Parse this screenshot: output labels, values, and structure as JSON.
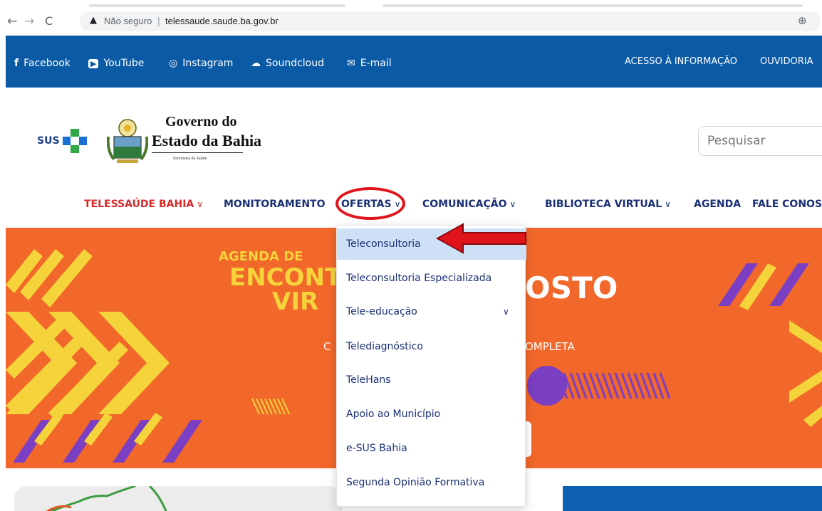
{
  "browser": {
    "url_warning": "Não seguro",
    "url_separator": "|",
    "url": "telessaude.saude.ba.gov.br",
    "back_glyph": "←",
    "forward_glyph": "→",
    "reload_glyph": "C",
    "warn_glyph": "▲",
    "zoom_glyph": "⊕"
  },
  "social": [
    {
      "icon": "facebook-icon",
      "glyph": "f",
      "label": "Facebook"
    },
    {
      "icon": "youtube-icon",
      "glyph": "▶",
      "label": "YouTube"
    },
    {
      "icon": "instagram-icon",
      "glyph": "◎",
      "label": "Instagram"
    },
    {
      "icon": "soundcloud-icon",
      "glyph": "☁",
      "label": "Soundcloud"
    },
    {
      "icon": "email-icon",
      "glyph": "✉",
      "label": "E-mail"
    }
  ],
  "top_links": {
    "info": "ACESSO À INFORMAÇÃO",
    "ouvidoria": "OUVIDORIA"
  },
  "logo": {
    "sus": "SUS",
    "gov_line1": "Governo do",
    "gov_line2": "Estado da Bahia",
    "gov_line3": "Secretaria da Saúde"
  },
  "search": {
    "placeholder": "Pesquisar"
  },
  "nav": [
    {
      "label": "TELESSAÚDE BAHIA",
      "chevron": "∨"
    },
    {
      "label": "MONITORAMENTO",
      "chevron": ""
    },
    {
      "label": "OFERTAS",
      "chevron": "∨"
    },
    {
      "label": "COMUNICAÇÃO",
      "chevron": "∨"
    },
    {
      "label": "BIBLIOTECA VIRTUAL",
      "chevron": "∨"
    },
    {
      "label": "AGENDA",
      "chevron": ""
    },
    {
      "label": "FALE CONOS",
      "chevron": ""
    }
  ],
  "banner": {
    "title1": "AGENDA DE",
    "title2": "ENCONT",
    "title3": "VIR",
    "big": "OSTO",
    "sub_left": "C",
    "sub_right": "OMPLETA"
  },
  "dropdown": {
    "items": [
      {
        "label": "Teleconsultoria",
        "chevron": ""
      },
      {
        "label": "Teleconsultoria Especializada",
        "chevron": ""
      },
      {
        "label": "Tele-educação",
        "chevron": "∨"
      },
      {
        "label": "Telediagnóstico",
        "chevron": ""
      },
      {
        "label": "TeleHans",
        "chevron": ""
      },
      {
        "label": "Apoio ao Município",
        "chevron": ""
      },
      {
        "label": "e-SUS Bahia",
        "chevron": ""
      },
      {
        "label": "Segunda Opinião Formativa",
        "chevron": ""
      }
    ],
    "highlighted_index": 0
  },
  "colors": {
    "social_bar": "#0b5aa6",
    "nav_text": "#1a2f74",
    "nav_active": "#d62a2a",
    "banner": "#f2672a",
    "banner_yellow": "#f4d43a",
    "banner_purple": "#7a3fc2",
    "annotation_red": "#e0141b",
    "dropdown_highlight": "#cde0f6"
  }
}
